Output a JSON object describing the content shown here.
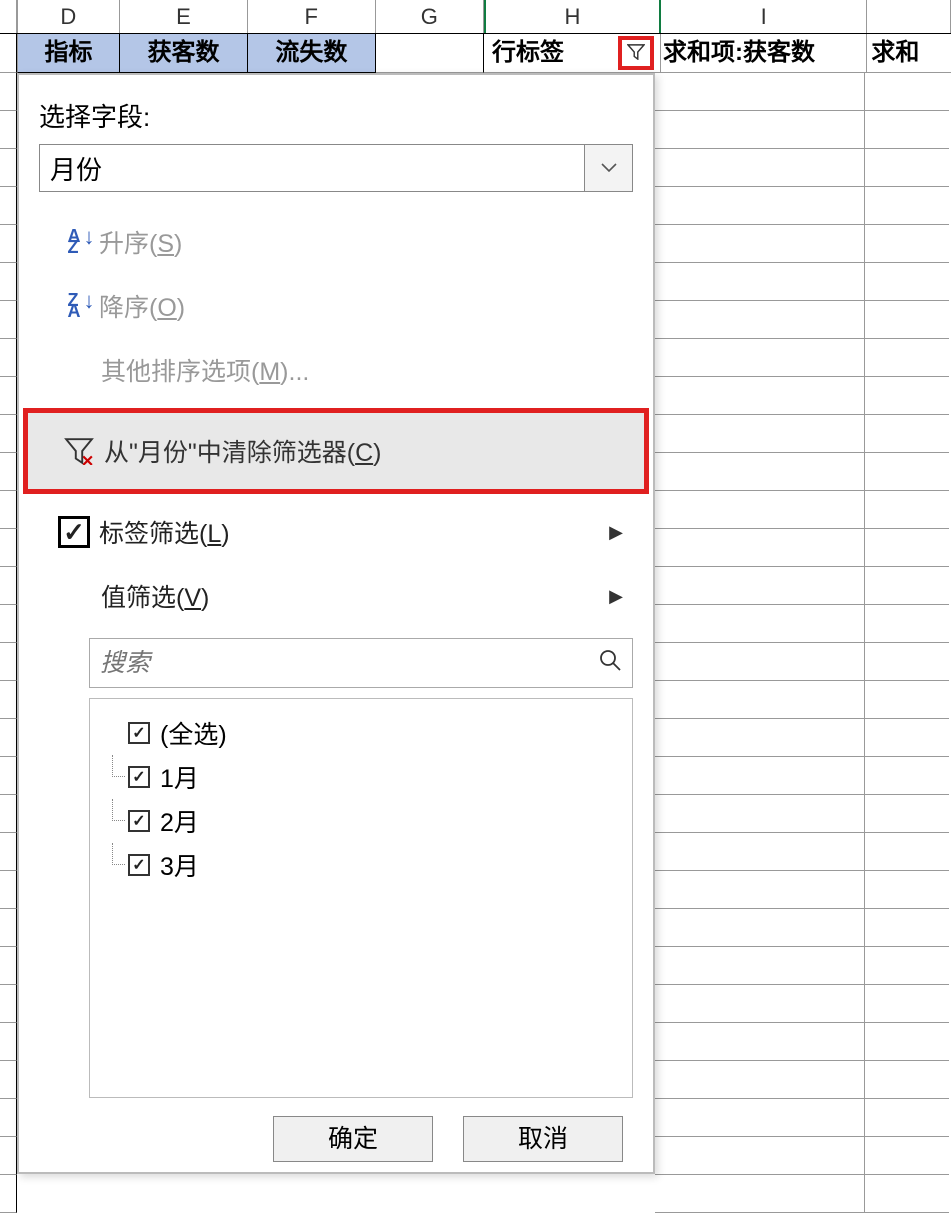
{
  "columns": {
    "D": "D",
    "E": "E",
    "F": "F",
    "G": "G",
    "H": "H",
    "I": "I"
  },
  "headers": {
    "D": "指标",
    "E": "获客数",
    "F": "流失数",
    "G": "",
    "H": "行标签",
    "I": "求和项:获客数",
    "J": "求和"
  },
  "dropdown": {
    "select_field_label": "选择字段:",
    "selected_field": "月份",
    "sort_asc": "升序",
    "sort_asc_key": "S",
    "sort_desc": "降序",
    "sort_desc_key": "O",
    "more_sort": "其他排序选项",
    "more_sort_key": "M",
    "clear_filter": "从\"月份\"中清除筛选器",
    "clear_filter_key": "C",
    "label_filter": "标签筛选",
    "label_filter_key": "L",
    "value_filter": "值筛选",
    "value_filter_key": "V",
    "search_placeholder": "搜索",
    "tree": {
      "select_all": "(全选)",
      "items": [
        "1月",
        "2月",
        "3月"
      ]
    },
    "ok": "确定",
    "cancel": "取消"
  }
}
